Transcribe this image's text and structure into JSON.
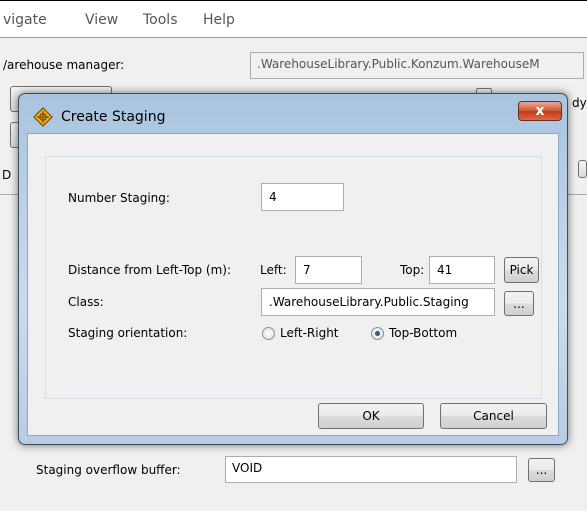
{
  "menubar": {
    "items": [
      "vigate",
      "View",
      "Tools",
      "Help"
    ]
  },
  "background": {
    "warehouse_manager_label": "/arehouse manager:",
    "warehouse_manager_value": ".WarehouseLibrary.Public.Konzum.WarehouseM",
    "partial_right_text": "dy",
    "partial_left_letter": "D",
    "overflow_buffer_label": "Staging overflow buffer:",
    "overflow_buffer_value": "VOID",
    "overflow_browse_label": "..."
  },
  "dialog": {
    "title": "Create Staging",
    "close_label": "x",
    "number_staging_label": "Number Staging:",
    "number_staging_value": "4",
    "distance_label": "Distance from Left-Top (m):",
    "left_label": "Left:",
    "left_value": "7",
    "top_label": "Top:",
    "top_value": "41",
    "pick_label": "Pick",
    "class_label": "Class:",
    "class_value": ".WarehouseLibrary.Public.Staging",
    "class_browse_label": "...",
    "orientation_label": "Staging orientation:",
    "orientation_options": [
      "Left-Right",
      "Top-Bottom"
    ],
    "orientation_selected": "Top-Bottom",
    "ok_label": "OK",
    "cancel_label": "Cancel"
  }
}
